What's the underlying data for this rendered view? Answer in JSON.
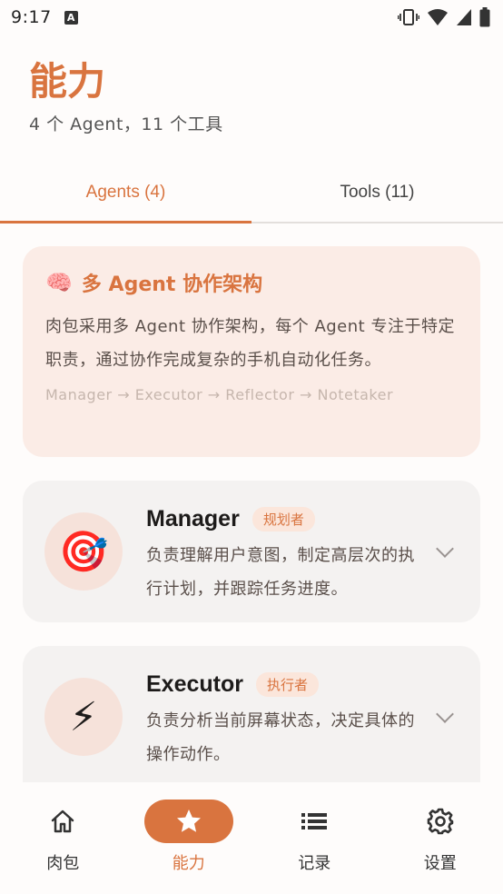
{
  "status_bar": {
    "time": "9:17",
    "icons": [
      "font-badge-icon",
      "vibrate-icon",
      "wifi-icon",
      "signal-icon",
      "battery-icon"
    ]
  },
  "header": {
    "title": "能力",
    "subtitle": "4 个 Agent，11 个工具"
  },
  "tabs": [
    {
      "label": "Agents (4)",
      "active": true
    },
    {
      "label": "Tools (11)",
      "active": false
    }
  ],
  "info_card": {
    "emoji": "🧠",
    "title": "多 Agent 协作架构",
    "body": "肉包采用多 Agent 协作架构，每个 Agent 专注于特定职责，通过协作完成复杂的手机自动化任务。",
    "flow": "Manager → Executor → Reflector → Notetaker"
  },
  "agents": [
    {
      "icon": "🎯",
      "name": "Manager",
      "role": "规划者",
      "description": "负责理解用户意图，制定高层次的执行计划，并跟踪任务进度。"
    },
    {
      "icon": "⚡",
      "name": "Executor",
      "role": "执行者",
      "description": "负责分析当前屏幕状态，决定具体的操作动作。"
    }
  ],
  "bottom_nav": [
    {
      "label": "肉包",
      "icon": "home-icon",
      "active": false
    },
    {
      "label": "能力",
      "icon": "star-icon",
      "active": true
    },
    {
      "label": "记录",
      "icon": "list-icon",
      "active": false
    },
    {
      "label": "设置",
      "icon": "gear-icon",
      "active": false
    }
  ],
  "colors": {
    "accent": "#d9743f",
    "info_card_bg": "#fbece6",
    "agent_card_bg": "#f4f2f1"
  }
}
